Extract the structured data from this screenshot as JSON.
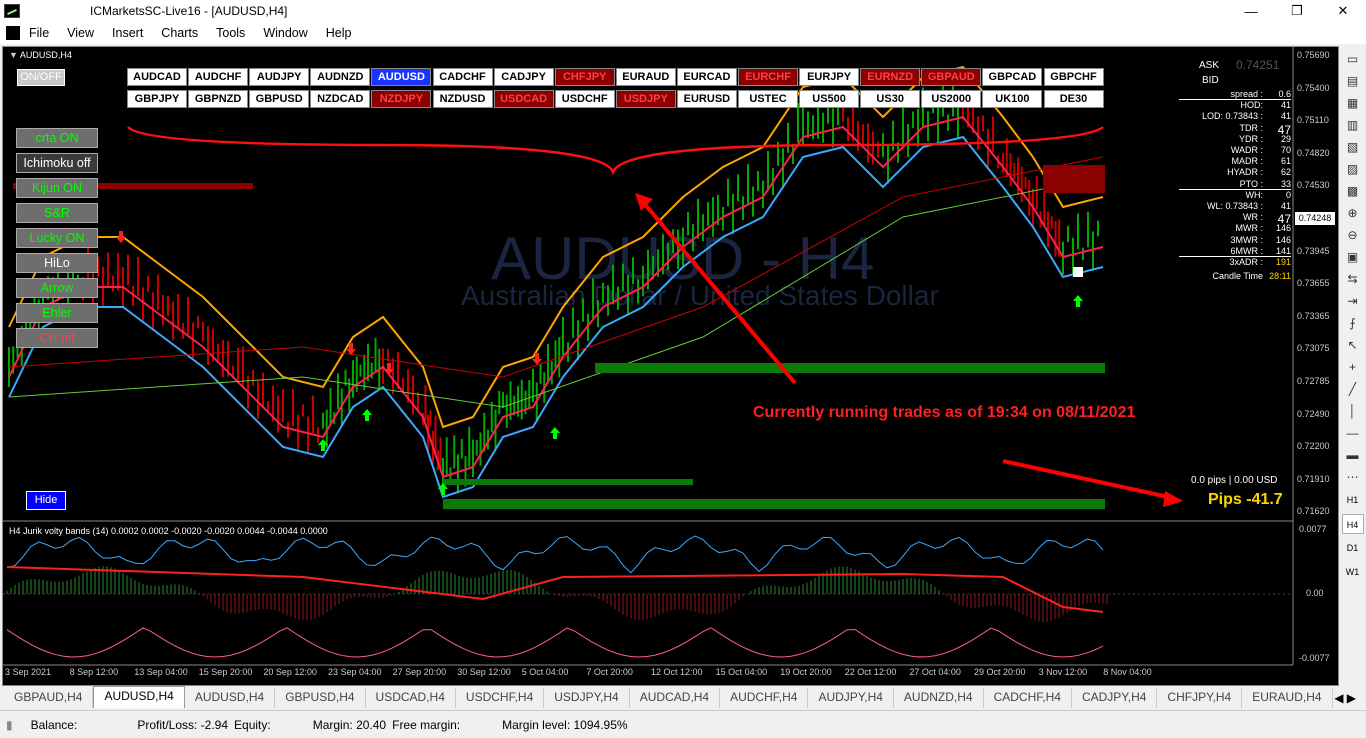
{
  "window": {
    "title": "ICMarketsSC-Live16 - [AUDUSD,H4]",
    "minimize": "—",
    "restore": "❐",
    "close": "✕"
  },
  "menu": [
    "File",
    "View",
    "Insert",
    "Charts",
    "Tools",
    "Window",
    "Help"
  ],
  "chart": {
    "symbol_label": "AUDUSD,H4",
    "watermark_symbol": "AUDUSD - H4",
    "watermark_name": "Australian Dollar / United States Dollar",
    "on_off_label": "ON/OFF",
    "hide_label": "Hide",
    "annotation": "Currently running trades as of 19:34 on 08/11/2021",
    "pips_label": "0.0 pips | 0.00 USD",
    "pips_value": "Pips -41.7",
    "current_price": "0.74248",
    "colors": {
      "bull": "#00aa00",
      "bear": "#cc0000",
      "accent": "#ff0000",
      "orange": "#ffa500",
      "skyblue": "#3aaaff"
    }
  },
  "symbols_row1": [
    {
      "label": "AUDCAD",
      "state": "normal"
    },
    {
      "label": "AUDCHF",
      "state": "normal"
    },
    {
      "label": "AUDJPY",
      "state": "normal"
    },
    {
      "label": "AUDNZD",
      "state": "normal"
    },
    {
      "label": "AUDUSD",
      "state": "active"
    },
    {
      "label": "CADCHF",
      "state": "normal"
    },
    {
      "label": "CADJPY",
      "state": "normal"
    },
    {
      "label": "CHFJPY",
      "state": "red"
    },
    {
      "label": "EURAUD",
      "state": "normal"
    },
    {
      "label": "EURCAD",
      "state": "normal"
    },
    {
      "label": "EURCHF",
      "state": "red"
    },
    {
      "label": "EURJPY",
      "state": "normal"
    },
    {
      "label": "EURNZD",
      "state": "red"
    },
    {
      "label": "GBPAUD",
      "state": "red"
    },
    {
      "label": "GBPCAD",
      "state": "normal"
    },
    {
      "label": "GBPCHF",
      "state": "normal"
    }
  ],
  "symbols_row2": [
    {
      "label": "GBPJPY",
      "state": "normal"
    },
    {
      "label": "GBPNZD",
      "state": "normal"
    },
    {
      "label": "GBPUSD",
      "state": "normal"
    },
    {
      "label": "NZDCAD",
      "state": "normal"
    },
    {
      "label": "NZDJPY",
      "state": "red"
    },
    {
      "label": "NZDUSD",
      "state": "normal"
    },
    {
      "label": "USDCAD",
      "state": "red"
    },
    {
      "label": "USDCHF",
      "state": "normal"
    },
    {
      "label": "USDJPY",
      "state": "red"
    },
    {
      "label": "EURUSD",
      "state": "normal"
    },
    {
      "label": "USTEC",
      "state": "normal"
    },
    {
      "label": "US500",
      "state": "normal"
    },
    {
      "label": "US30",
      "state": "normal"
    },
    {
      "label": "US2000",
      "state": "normal"
    },
    {
      "label": "UK100",
      "state": "normal"
    },
    {
      "label": "DE30",
      "state": "normal"
    }
  ],
  "left_buttons": [
    {
      "label": "crta ON",
      "style": "green"
    },
    {
      "label": "Ichimoku off",
      "style": "dark"
    },
    {
      "label": "Kijun ON",
      "style": "green"
    },
    {
      "label": "S&R",
      "style": "green"
    },
    {
      "label": "Lucky ON",
      "style": "green"
    },
    {
      "label": "HiLo",
      "style": "white"
    },
    {
      "label": "Arrow",
      "style": "green"
    },
    {
      "label": "Ehler",
      "style": "green"
    },
    {
      "label": "CH off",
      "style": "red"
    }
  ],
  "info_panel": {
    "ask_label": "ASK",
    "ask_value": "0.74251",
    "bid_label": "BID",
    "rows": [
      {
        "label": "spread :",
        "value": "0.6"
      },
      {
        "label": "HOD:",
        "value": "41"
      },
      {
        "label": "LOD: 0.73843 :",
        "value": "41"
      },
      {
        "label": "TDR :",
        "value": "47"
      },
      {
        "label": "YDR :",
        "value": "29"
      },
      {
        "label": "WADR :",
        "value": "70"
      },
      {
        "label": "MADR :",
        "value": "61"
      },
      {
        "label": "HYADR :",
        "value": "62"
      },
      {
        "label": "PTO :",
        "value": "33"
      },
      {
        "label": "WH:",
        "value": "0"
      },
      {
        "label": "WL: 0.73843 :",
        "value": "41"
      },
      {
        "label": "WR :",
        "value": "47"
      },
      {
        "label": "MWR :",
        "value": "146"
      },
      {
        "label": "3MWR :",
        "value": "146"
      },
      {
        "label": "6MWR :",
        "value": "141"
      },
      {
        "label": "3xADR :",
        "value": "191"
      },
      {
        "label": "Candle Time",
        "value": "28:11"
      }
    ]
  },
  "price_axis": [
    "0.75690",
    "0.75400",
    "0.75110",
    "0.74820",
    "0.74530",
    "0.74248",
    "0.73945",
    "0.73655",
    "0.73365",
    "0.73075",
    "0.72785",
    "0.72490",
    "0.72200",
    "0.71910",
    "0.71620"
  ],
  "indicator": {
    "label": "H4 Jurik volty bands (14) 0.0002 0.0002 -0.0020 -0.0020 0.0044 -0.0044 0.0000",
    "axis": [
      "0.0077",
      "0.00",
      "-0.0077"
    ]
  },
  "time_axis": [
    "3 Sep 2021",
    "8 Sep 12:00",
    "13 Sep 04:00",
    "15 Sep 20:00",
    "20 Sep 12:00",
    "23 Sep 04:00",
    "27 Sep 20:00",
    "30 Sep 12:00",
    "5 Oct 04:00",
    "7 Oct 20:00",
    "12 Oct 12:00",
    "15 Oct 04:00",
    "19 Oct 20:00",
    "22 Oct 12:00",
    "27 Oct 04:00",
    "29 Oct 20:00",
    "3 Nov 12:00",
    "8 Nov 04:00"
  ],
  "tabs": [
    "GBPAUD,H4",
    "AUDUSD,H4",
    "AUDUSD,H4",
    "GBPUSD,H4",
    "USDCAD,H4",
    "USDCHF,H4",
    "USDJPY,H4",
    "AUDCAD,H4",
    "AUDCHF,H4",
    "AUDJPY,H4",
    "AUDNZD,H4",
    "CADCHF,H4",
    "CADJPY,H4",
    "CHFJPY,H4",
    "EURAUD,H4"
  ],
  "status": {
    "balance": "Balance:",
    "profit": "Profit/Loss: -2.94",
    "equity": "Equity:",
    "margin": "Margin: 20.40",
    "free_margin": "Free margin:",
    "margin_level": "Margin level: 1094.95%"
  },
  "timeframes": [
    "H1",
    "H4",
    "D1",
    "W1"
  ]
}
